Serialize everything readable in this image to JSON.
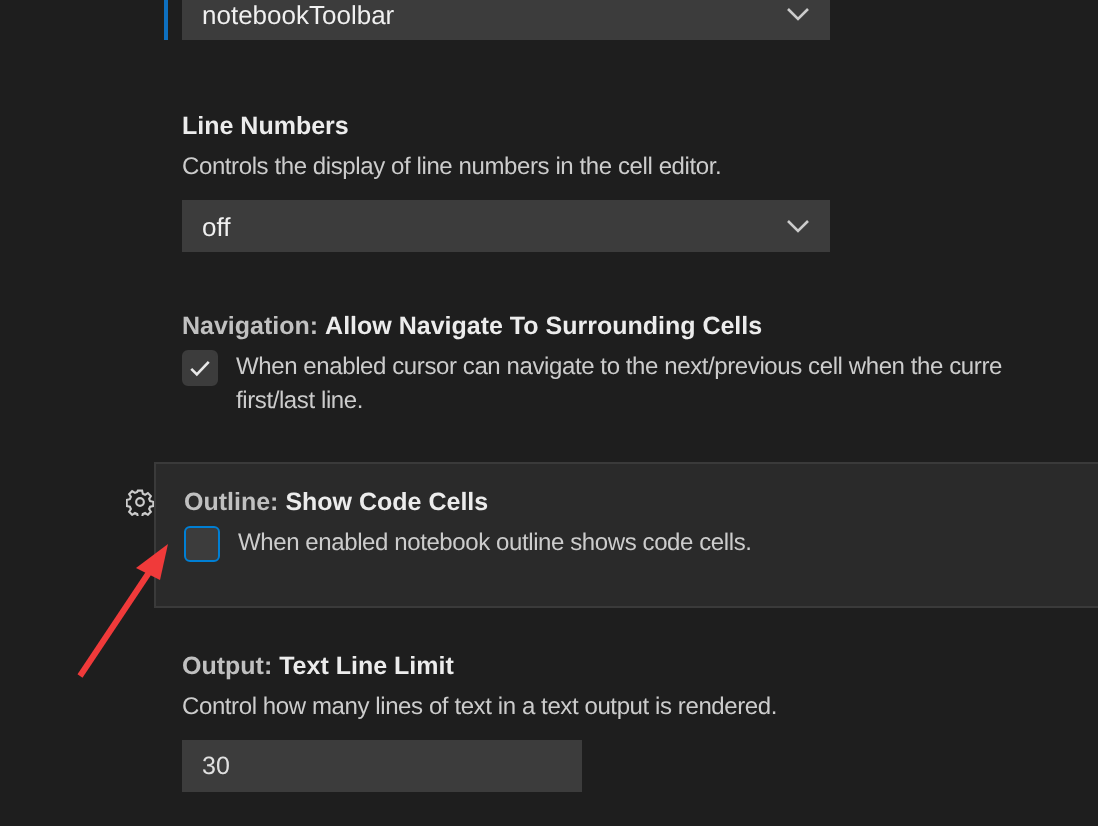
{
  "settings": [
    {
      "kind": "dropdown",
      "focused": true,
      "highlighted": false,
      "value": "notebookToolbar"
    },
    {
      "kind": "dropdown",
      "focused": false,
      "highlighted": false,
      "name": "Line Numbers",
      "description": [
        "Controls the display of line numbers in the cell editor."
      ],
      "value": "off"
    },
    {
      "kind": "checkbox",
      "focused": false,
      "highlighted": false,
      "category": "Navigation: ",
      "name": "Allow Navigate To Surrounding Cells",
      "description": [
        "When enabled cursor can navigate to the next/previous cell when the curre",
        "first/last line."
      ],
      "checked": true
    },
    {
      "kind": "checkbox",
      "focused": false,
      "highlighted": true,
      "category": "Outline: ",
      "name": "Show Code Cells",
      "description": [
        "When enabled notebook outline shows code cells."
      ],
      "checked": false
    },
    {
      "kind": "number",
      "focused": false,
      "highlighted": false,
      "category": "Output: ",
      "name": "Text Line Limit",
      "description": [
        "Control how many lines of text in a text output is rendered."
      ],
      "value": "30"
    }
  ]
}
